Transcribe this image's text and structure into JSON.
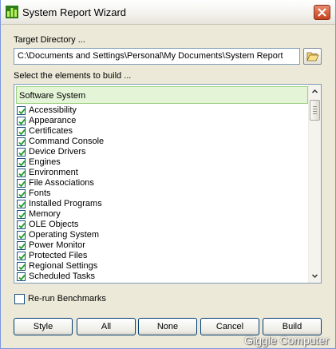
{
  "window": {
    "title": "System Report Wizard",
    "close_icon": "close-icon"
  },
  "target": {
    "label": "Target Directory ...",
    "value": "C:\\Documents and Settings\\Personal\\My Documents\\System Report",
    "browse_icon": "folder-open-icon"
  },
  "list": {
    "label": "Select the elements to build ...",
    "header": "Software System",
    "items": [
      {
        "label": "Accessibility",
        "checked": true
      },
      {
        "label": "Appearance",
        "checked": true
      },
      {
        "label": "Certificates",
        "checked": true
      },
      {
        "label": "Command Console",
        "checked": true
      },
      {
        "label": "Device Drivers",
        "checked": true
      },
      {
        "label": "Engines",
        "checked": true
      },
      {
        "label": "Environment",
        "checked": true
      },
      {
        "label": "File Associations",
        "checked": true
      },
      {
        "label": "Fonts",
        "checked": true
      },
      {
        "label": "Installed Programs",
        "checked": true
      },
      {
        "label": "Memory",
        "checked": true
      },
      {
        "label": "OLE Objects",
        "checked": true
      },
      {
        "label": "Operating System",
        "checked": true
      },
      {
        "label": "Power Monitor",
        "checked": true
      },
      {
        "label": "Protected Files",
        "checked": true
      },
      {
        "label": "Regional Settings",
        "checked": true
      },
      {
        "label": "Scheduled Tasks",
        "checked": true
      }
    ]
  },
  "options": {
    "rerun_label": "Re-run Benchmarks",
    "rerun_checked": false
  },
  "buttons": {
    "style": "Style",
    "all": "All",
    "none": "None",
    "cancel": "Cancel",
    "build": "Build"
  },
  "watermark": "Giggle Computer",
  "colors": {
    "title_bar": "#f4f3ee",
    "face": "#ece9d8",
    "close": "#c6421d",
    "header_bg": "#e4f5d7",
    "check": "#21a121"
  }
}
